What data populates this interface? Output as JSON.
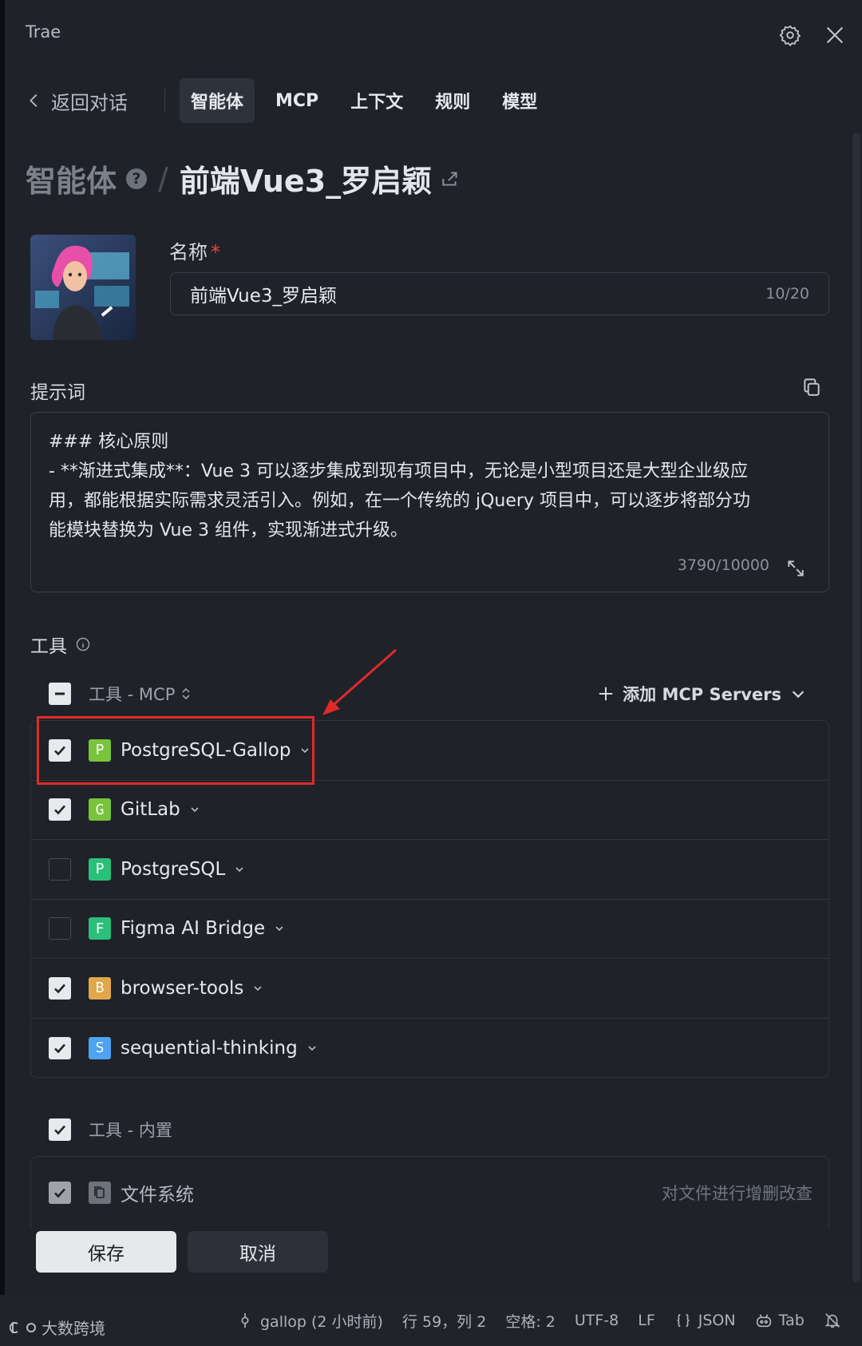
{
  "window": {
    "title": "Trae"
  },
  "nav": {
    "back_label": "返回对话",
    "tabs": [
      {
        "label": "智能体",
        "active": true
      },
      {
        "label": "MCP",
        "active": false
      },
      {
        "label": "上下文",
        "active": false
      },
      {
        "label": "规则",
        "active": false
      },
      {
        "label": "模型",
        "active": false
      }
    ]
  },
  "heading": {
    "section": "智能体",
    "agent_name": "前端Vue3_罗启颖"
  },
  "form": {
    "name_label": "名称",
    "required_mark": "*",
    "name_value": "前端Vue3_罗启颖",
    "name_count": "10/20",
    "prompt_label": "提示词",
    "prompt_lines": [
      "### 核心原则",
      "- **渐进式集成**：Vue 3 可以逐步集成到现有项目中，无论是小型项目还是大型企业级应",
      "用，都能根据实际需求灵活引入。例如，在一个传统的 jQuery 项目中，可以逐步将部分功",
      "能模块替换为 Vue 3 组件，实现渐进式升级。"
    ],
    "prompt_count": "3790/10000"
  },
  "tools": {
    "label": "工具",
    "mcp_group_title": "工具 - MCP",
    "add_mcp_label": "添加 MCP Servers",
    "mcp_servers": [
      {
        "badge": "P",
        "name": "PostgreSQL-Gallop",
        "checked": true,
        "color": "#78c43c"
      },
      {
        "badge": "G",
        "name": "GitLab",
        "checked": true,
        "color": "#78c43c"
      },
      {
        "badge": "P",
        "name": "PostgreSQL",
        "checked": false,
        "color": "#2bc07a"
      },
      {
        "badge": "F",
        "name": "Figma AI Bridge",
        "checked": false,
        "color": "#2bc07a"
      },
      {
        "badge": "B",
        "name": "browser-tools",
        "checked": true,
        "color": "#e0a84a"
      },
      {
        "badge": "S",
        "name": "sequential-thinking",
        "checked": true,
        "color": "#4ea3f2"
      }
    ],
    "builtin_group_title": "工具 - 内置",
    "builtin": [
      {
        "name": "文件系统",
        "desc": "对文件进行增删改查"
      }
    ]
  },
  "actions": {
    "save": "保存",
    "cancel": "取消"
  },
  "statusbar": {
    "branch": "gallop (2 小时前)",
    "position": "行 59，列 2",
    "spaces": "空格: 2",
    "encoding": "UTF-8",
    "eol": "LF",
    "language": "JSON",
    "indent": "Tab"
  },
  "watermark": "大数跨境",
  "colors": {
    "highlight": "#e02a2a",
    "accent_checkbox": "#e8e9ec"
  }
}
